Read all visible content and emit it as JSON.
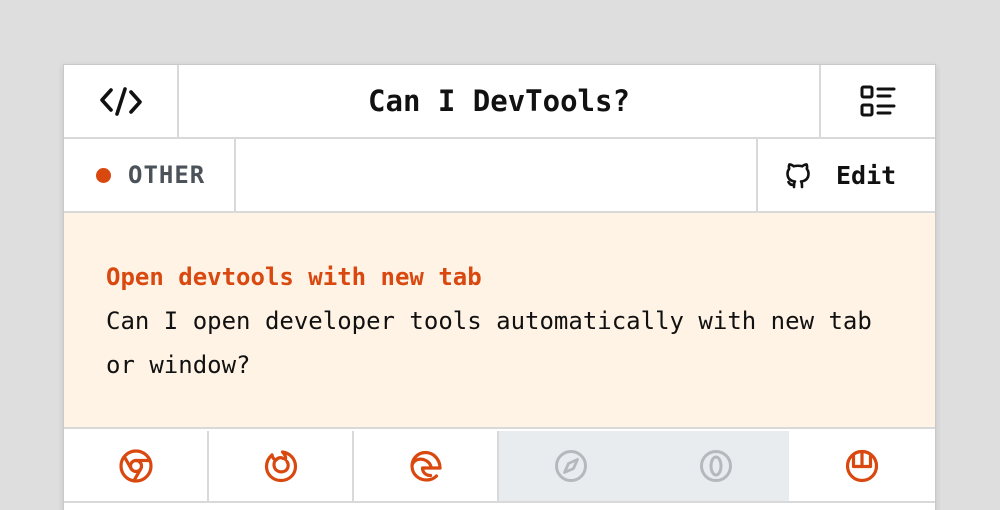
{
  "header": {
    "title": "Can I DevTools?",
    "left_icon": "code-icon",
    "right_icon": "list-icon"
  },
  "category": {
    "label": "OTHER",
    "dot_color": "#d9480f"
  },
  "edit": {
    "label": "Edit",
    "icon": "github-icon"
  },
  "question": {
    "title": "Open devtools with new tab",
    "description": "Can I open developer tools automatically with new tab or window?"
  },
  "browsers": [
    {
      "name": "chrome-icon",
      "supported": true
    },
    {
      "name": "firefox-icon",
      "supported": true
    },
    {
      "name": "edge-icon",
      "supported": true
    },
    {
      "name": "safari-icon",
      "supported": false
    },
    {
      "name": "opera-icon",
      "supported": false
    },
    {
      "name": "brave-icon",
      "supported": true
    }
  ],
  "colors": {
    "accent": "#d9480f",
    "question_bg": "#fff3e6",
    "disabled_bg": "#e9ecef",
    "disabled_icon": "#b5b9bd"
  }
}
